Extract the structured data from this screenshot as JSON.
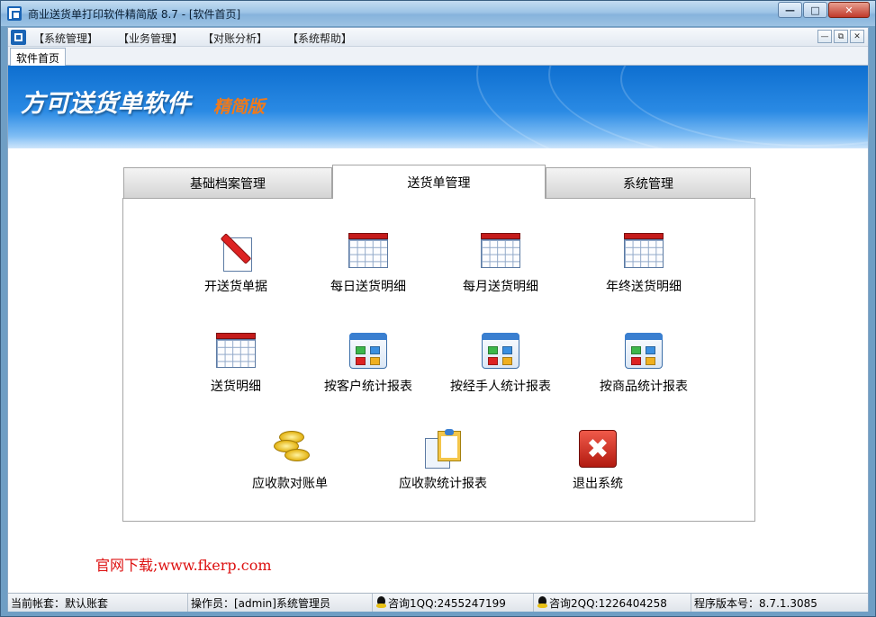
{
  "window": {
    "title": "商业送货单打印软件精简版 8.7 - [软件首页]"
  },
  "menubar": {
    "items": [
      "【系统管理】",
      "【业务管理】",
      "【对账分析】",
      "【系统帮助】"
    ]
  },
  "doc_tab": {
    "label": "软件首页"
  },
  "banner": {
    "title": "方可送货单软件",
    "subtitle": "精简版"
  },
  "tabs": [
    {
      "label": "基础档案管理",
      "active": false
    },
    {
      "label": "送货单管理",
      "active": true
    },
    {
      "label": "系统管理",
      "active": false
    }
  ],
  "functions": [
    {
      "label": "开送货单据",
      "icon": "pencil-document-icon"
    },
    {
      "label": "每日送货明细",
      "icon": "table-icon"
    },
    {
      "label": "每月送货明细",
      "icon": "table-icon"
    },
    {
      "label": "年终送货明细",
      "icon": "table-icon"
    },
    {
      "label": "送货明细",
      "icon": "table-icon"
    },
    {
      "label": "按客户统计报表",
      "icon": "report-icon"
    },
    {
      "label": "按经手人统计报表",
      "icon": "report-icon"
    },
    {
      "label": "按商品统计报表",
      "icon": "report-icon"
    },
    {
      "label": "应收款对账单",
      "icon": "coins-icon"
    },
    {
      "label": "应收款统计报表",
      "icon": "clipboard-icon"
    },
    {
      "label": "退出系统",
      "icon": "exit-icon"
    }
  ],
  "download_text": "官网下载;www.fkerp.com",
  "statusbar": {
    "account": "当前帐套：默认账套",
    "operator": "操作员：[admin]系统管理员",
    "qq1": "咨询1QQ:2455247199",
    "qq2": "咨询2QQ:1226404258",
    "version": "程序版本号：8.7.1.3085"
  },
  "colors": {
    "accent": "#1a64b5",
    "exit_red": "#c41b1b",
    "download_text": "#dd1111",
    "banner_subtitle": "#f07a1a"
  }
}
